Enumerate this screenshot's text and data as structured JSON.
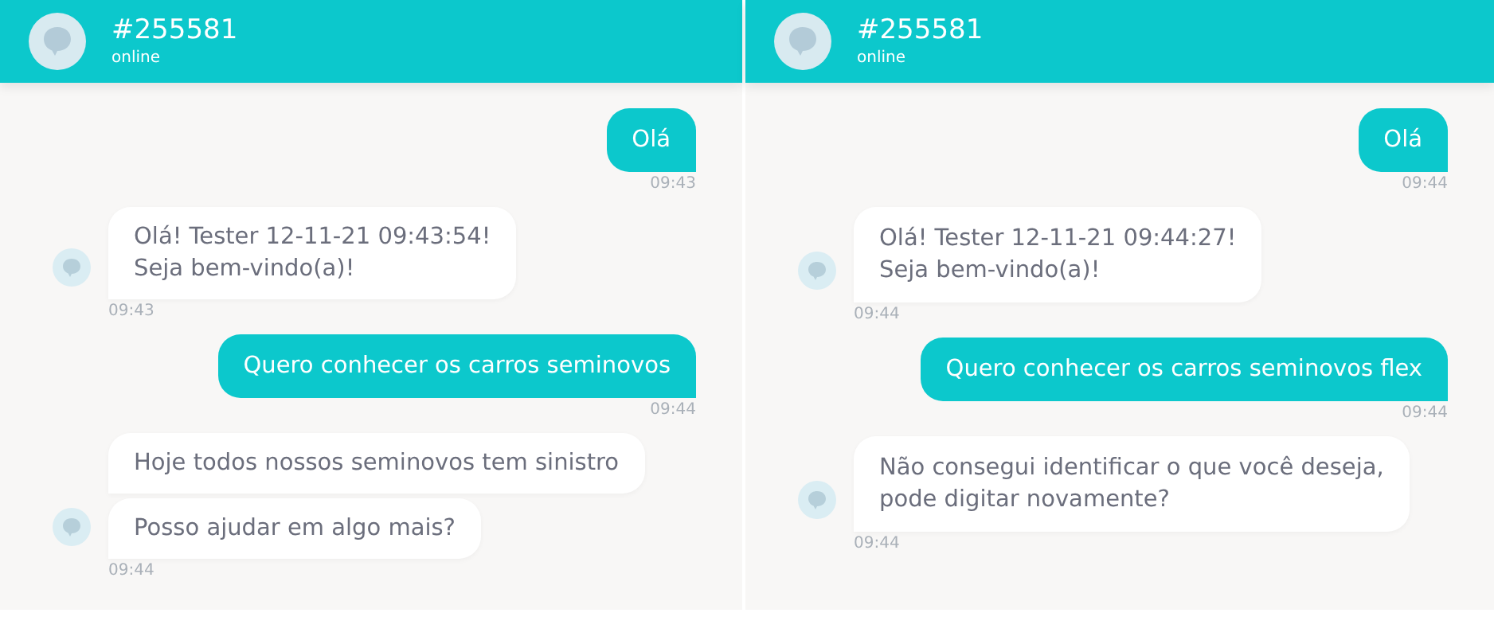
{
  "panels": [
    {
      "title": "#255581",
      "status": "online",
      "messages": [
        {
          "kind": "sent",
          "texts": [
            "Olá"
          ],
          "time": "09:43"
        },
        {
          "kind": "received",
          "texts": [
            "Olá! Tester 12-11-21 09:43:54!\nSeja bem-vindo(a)!"
          ],
          "time": "09:43"
        },
        {
          "kind": "sent",
          "texts": [
            "Quero conhecer os carros seminovos"
          ],
          "time": "09:44"
        },
        {
          "kind": "received",
          "texts": [
            "Hoje todos nossos seminovos tem sinistro",
            "Posso ajudar em algo mais?"
          ],
          "time": "09:44"
        }
      ]
    },
    {
      "title": "#255581",
      "status": "online",
      "messages": [
        {
          "kind": "sent",
          "texts": [
            "Olá"
          ],
          "time": "09:44"
        },
        {
          "kind": "received",
          "texts": [
            "Olá! Tester 12-11-21 09:44:27!\nSeja bem-vindo(a)!"
          ],
          "time": "09:44"
        },
        {
          "kind": "sent",
          "texts": [
            "Quero conhecer os carros seminovos flex"
          ],
          "time": "09:44"
        },
        {
          "kind": "received",
          "texts": [
            "Não consegui identificar o que você deseja,\npode digitar novamente?"
          ],
          "time": "09:44"
        }
      ]
    }
  ]
}
